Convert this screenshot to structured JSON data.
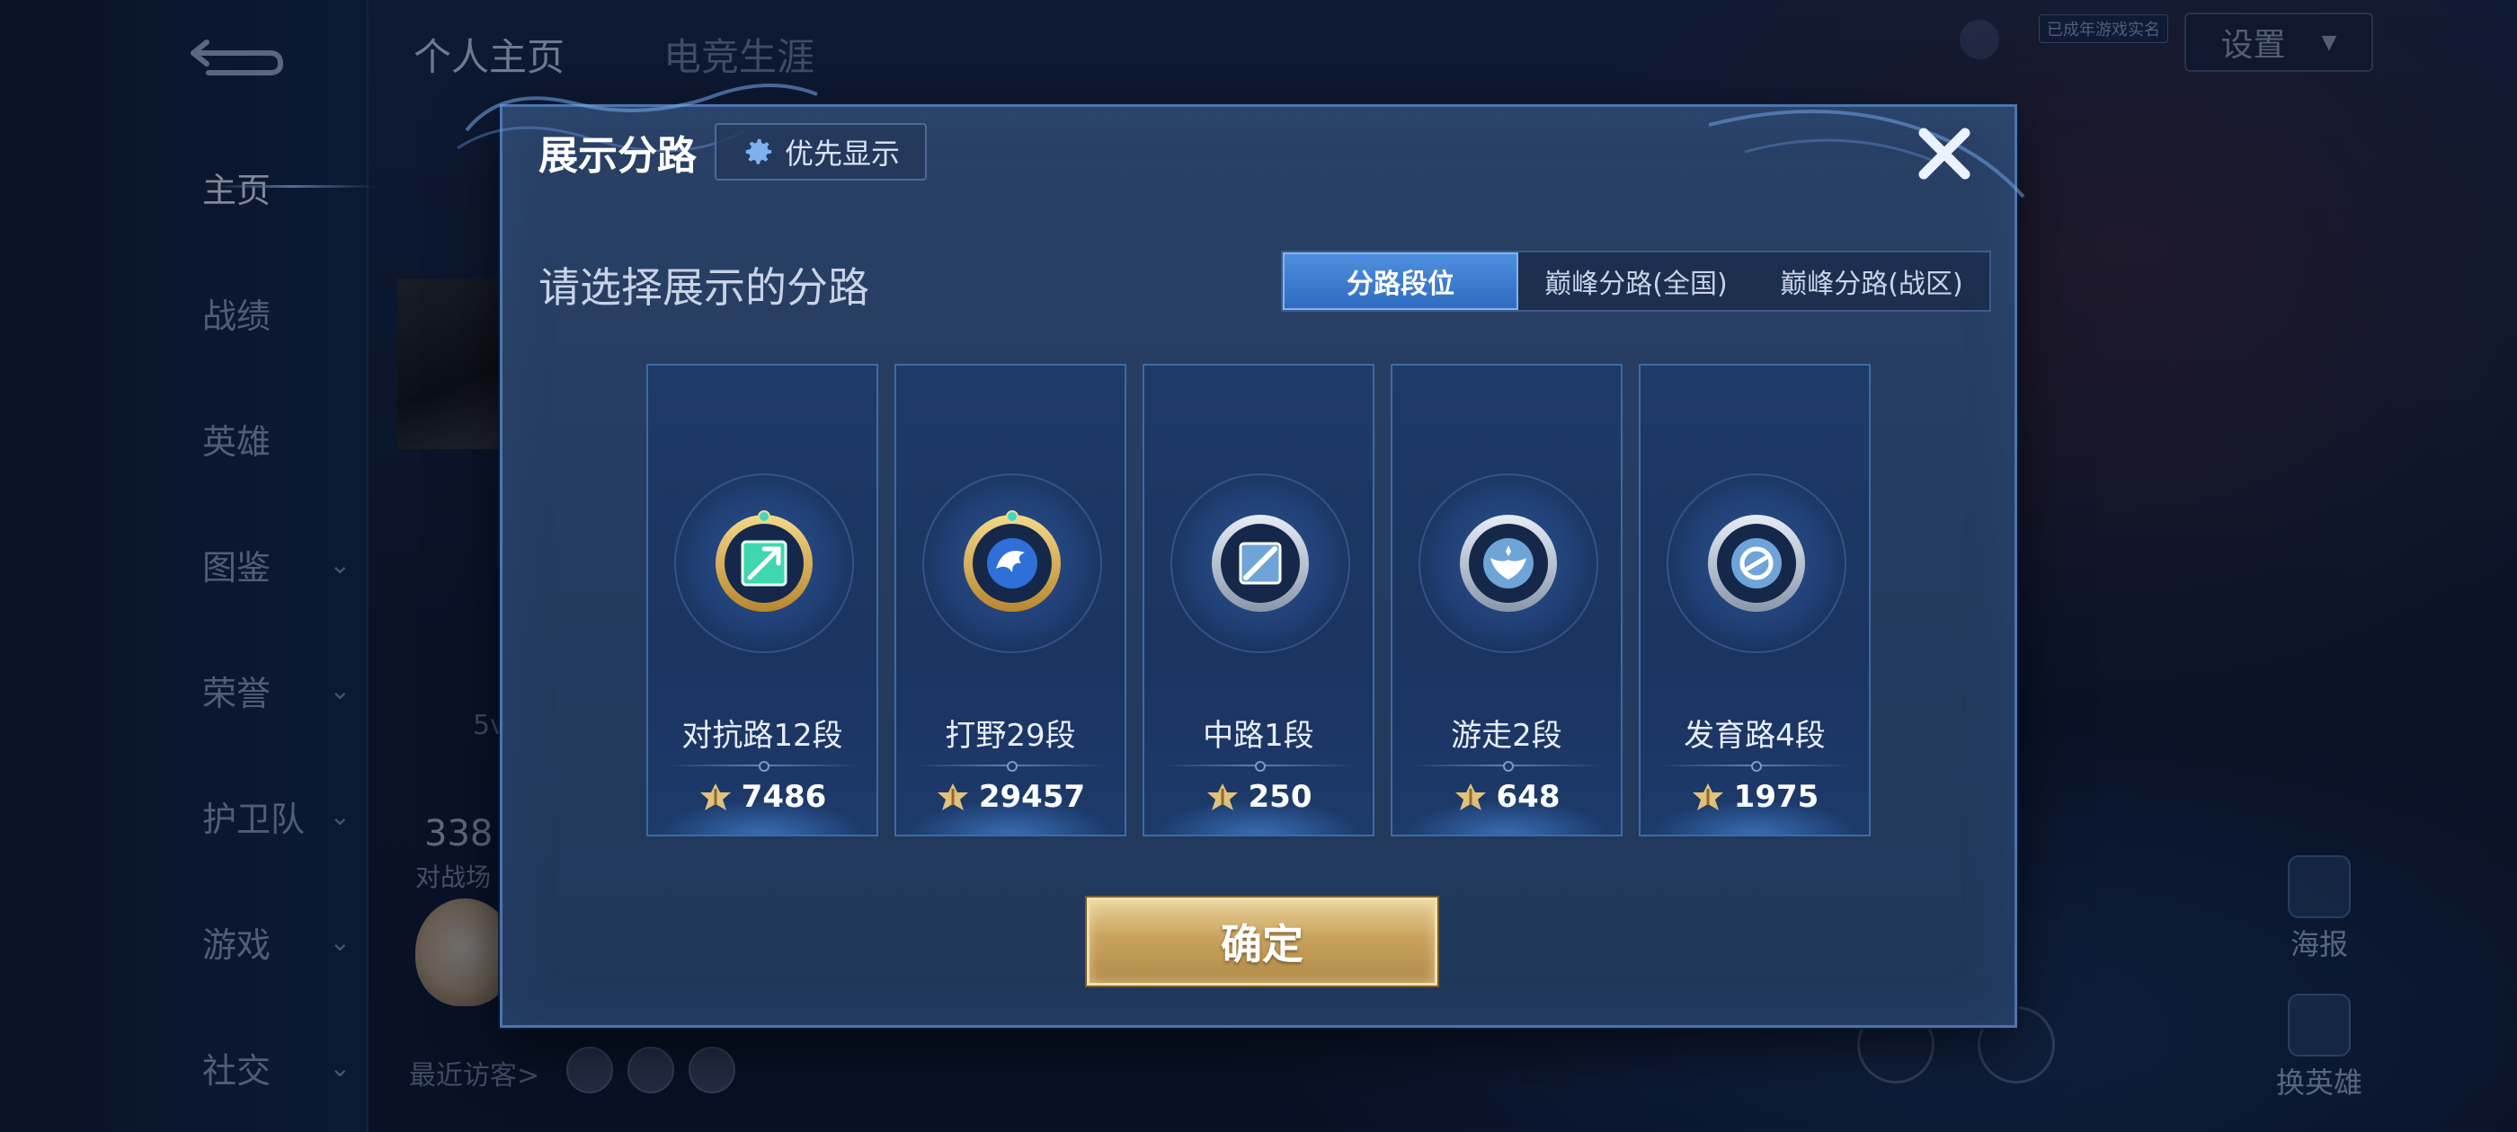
{
  "background": {
    "top_tabs": [
      {
        "label": "个人主页",
        "active": true
      },
      {
        "label": "电竞生涯",
        "active": false
      }
    ],
    "sidebar": {
      "items": [
        {
          "label": "主页",
          "has_chevron": false,
          "active": true
        },
        {
          "label": "战绩",
          "has_chevron": false,
          "active": false
        },
        {
          "label": "英雄",
          "has_chevron": false,
          "active": false
        },
        {
          "label": "图鉴",
          "has_chevron": true,
          "active": false
        },
        {
          "label": "荣誉",
          "has_chevron": true,
          "active": false
        },
        {
          "label": "护卫队",
          "has_chevron": true,
          "active": false
        },
        {
          "label": "游戏",
          "has_chevron": true,
          "active": false
        },
        {
          "label": "社交",
          "has_chevron": true,
          "active": false
        }
      ]
    },
    "settings_label": "设置",
    "realname_badge": "已成年游戏实名",
    "partial_number": "338",
    "partial_text": "对战场",
    "partial_5v": "5v",
    "recent_visitors_label": "最近访客>",
    "right_actions": [
      {
        "label": "海报",
        "icon": "poster-icon"
      },
      {
        "label": "换英雄",
        "icon": "swap-hero-icon"
      }
    ]
  },
  "dialog": {
    "title": "展示分路",
    "priority_button": {
      "label": "优先显示",
      "icon": "gear-icon"
    },
    "close_icon": "close-icon",
    "subtitle": "请选择展示的分路",
    "tabs": [
      {
        "label": "分路段位",
        "active": true
      },
      {
        "label": "巅峰分路(全国)",
        "active": false
      },
      {
        "label": "巅峰分路(战区)",
        "active": false
      }
    ],
    "lanes": [
      {
        "rank": "对抗路12段",
        "score": "7486",
        "icon": "clash-lane-badge-icon",
        "badge_color": "#3fd7b0",
        "tier": "gold"
      },
      {
        "rank": "打野29段",
        "score": "29457",
        "icon": "jungle-dragon-badge-icon",
        "badge_color": "#2f6fd8",
        "tier": "gold"
      },
      {
        "rank": "中路1段",
        "score": "250",
        "icon": "mid-lane-badge-icon",
        "badge_color": "#6fa4d8",
        "tier": "silver"
      },
      {
        "rank": "游走2段",
        "score": "648",
        "icon": "roam-wings-badge-icon",
        "badge_color": "#6fa4d8",
        "tier": "silver"
      },
      {
        "rank": "发育路4段",
        "score": "1975",
        "icon": "farm-lane-badge-icon",
        "badge_color": "#6fa4d8",
        "tier": "silver"
      }
    ],
    "score_icon": "lane-points-icon",
    "confirm_label": "确定"
  }
}
